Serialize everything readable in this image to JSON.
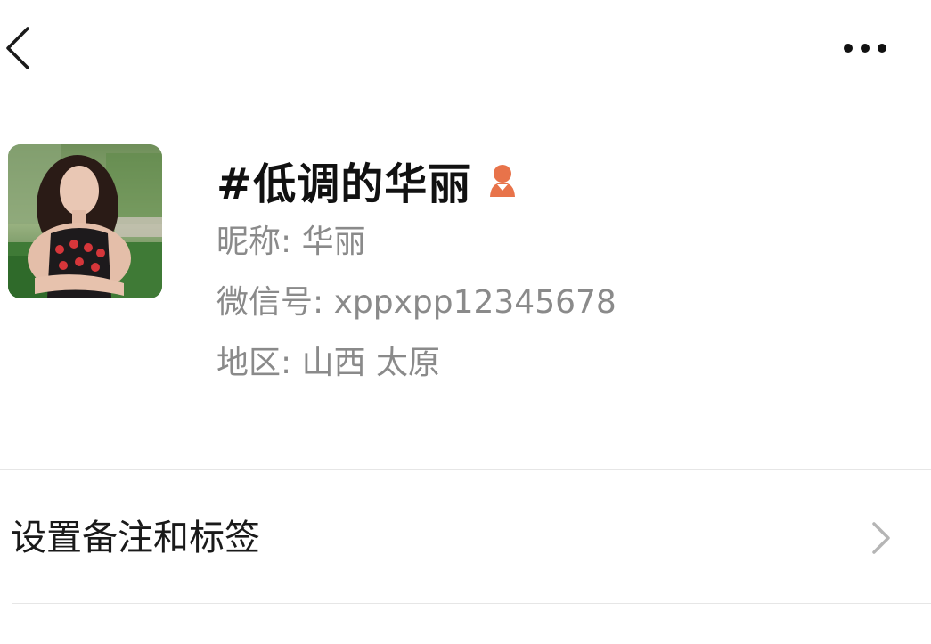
{
  "header": {
    "back_icon": "chevron-left-icon",
    "more_icon": "more-horizontal-icon"
  },
  "profile": {
    "display_name": "#低调的华丽",
    "gender_icon": "female-user-icon",
    "gender_icon_color": "#E8734A",
    "nickname": "昵称: 华丽",
    "wechat_id": "微信号: xppxpp12345678",
    "region": "地区: 山西  太原"
  },
  "menu": {
    "set_remark_label": "设置备注和标签",
    "chevron_icon": "chevron-right-icon"
  }
}
